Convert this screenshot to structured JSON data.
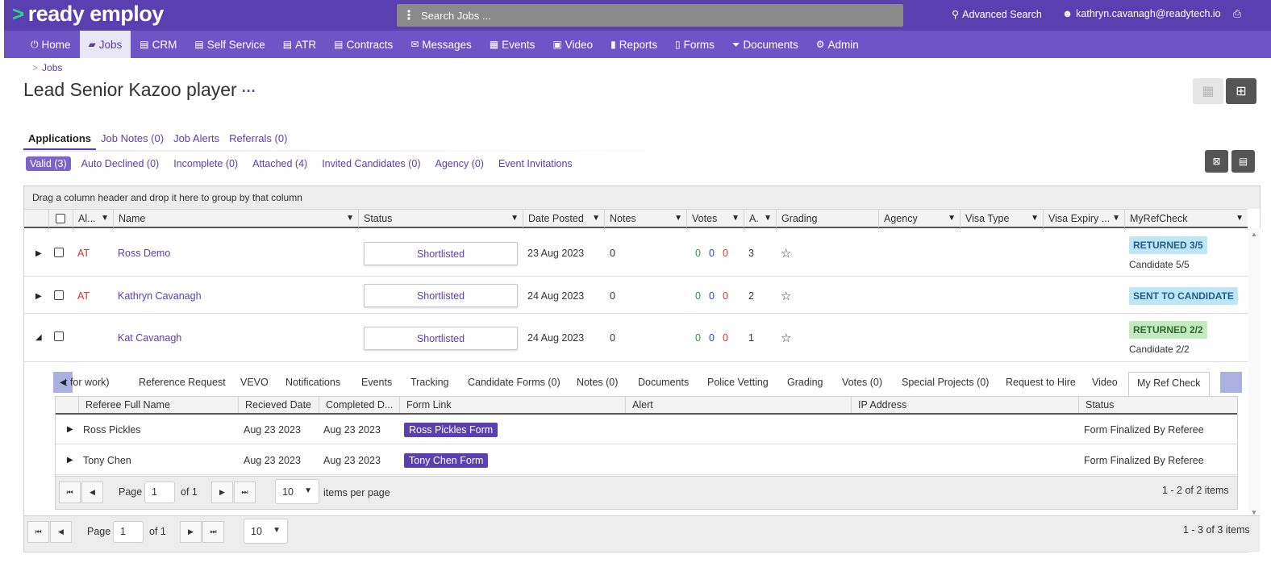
{
  "app": {
    "brand": "ready employ",
    "search_placeholder": "Search Jobs ...",
    "advanced_search": "Advanced Search",
    "user_email": "kathryn.cavanagh@readytech.io"
  },
  "nav": [
    {
      "label": "Home",
      "icon": "⏻"
    },
    {
      "label": "Jobs",
      "icon": "▰"
    },
    {
      "label": "CRM",
      "icon": "▤"
    },
    {
      "label": "Self Service",
      "icon": "▤"
    },
    {
      "label": "ATR",
      "icon": "▤"
    },
    {
      "label": "Contracts",
      "icon": "▤"
    },
    {
      "label": "Messages",
      "icon": "✉"
    },
    {
      "label": "Events",
      "icon": "▦"
    },
    {
      "label": "Video",
      "icon": "▣"
    },
    {
      "label": "Reports",
      "icon": "▮"
    },
    {
      "label": "Forms",
      "icon": "▯"
    },
    {
      "label": "Documents",
      "icon": "⏷"
    },
    {
      "label": "Admin",
      "icon": "⚙"
    }
  ],
  "breadcrumb": {
    "sep": ">",
    "item": "Jobs"
  },
  "page": {
    "title": "Lead Senior Kazoo player",
    "more": "···"
  },
  "main_tabs": [
    "Applications",
    "Job Notes (0)",
    "Job Alerts",
    "Referrals (0)"
  ],
  "sub_tabs": [
    "Valid (3)",
    "Auto Declined (0)",
    "Incomplete (0)",
    "Attached (4)",
    "Invited Candidates (0)",
    "Agency (0)",
    "Event Invitations"
  ],
  "grid": {
    "group_hint": "Drag a column header and drop it here to group by that column",
    "columns": [
      "Al...",
      "Name",
      "Status",
      "Date Posted",
      "Notes",
      "Votes",
      "A.",
      "Grading",
      "Agency",
      "Visa Type",
      "Visa Expiry ...",
      "MyRefCheck"
    ],
    "rows": [
      {
        "alert": "AT",
        "name": "Ross Demo",
        "status": "Shortlisted",
        "date": "23 Aug 2023",
        "notes": "0",
        "votes": [
          "0",
          "0",
          "0"
        ],
        "a": "3",
        "grading": "☆",
        "ref_badge": "RETURNED 3/5",
        "ref_sub": "Candidate 5/5",
        "expander": "▶"
      },
      {
        "alert": "AT",
        "name": "Kathryn Cavanagh",
        "status": "Shortlisted",
        "date": "24 Aug 2023",
        "notes": "0",
        "votes": [
          "0",
          "0",
          "0"
        ],
        "a": "2",
        "grading": "☆",
        "ref_badge": "SENT TO CANDIDATE",
        "ref_sub": "",
        "expander": "▶"
      },
      {
        "alert": "",
        "name": "Kat Cavanagh",
        "status": "Shortlisted",
        "date": "24 Aug 2023",
        "notes": "0",
        "votes": [
          "0",
          "0",
          "0"
        ],
        "a": "1",
        "grading": "☆",
        "ref_badge": "RETURNED 2/2",
        "ref_sub": "Candidate 2/2",
        "expander": "◢"
      }
    ],
    "pager": {
      "page_label": "Page",
      "page": "1",
      "of": "of 1",
      "size": "10",
      "summary": "1 - 3 of 3 items"
    }
  },
  "detail": {
    "tabs": [
      "t for work)",
      "Reference Request",
      "VEVO",
      "Notifications",
      "Events",
      "Tracking",
      "Candidate Forms (0)",
      "Notes (0)",
      "Documents",
      "Police Vetting",
      "Grading",
      "Votes (0)",
      "Special Projects (0)",
      "Request to Hire",
      "Video",
      "My Ref Check"
    ],
    "columns": [
      "Referee Full Name",
      "Recieved Date",
      "Completed D...",
      "Form Link",
      "Alert",
      "IP Address",
      "Status"
    ],
    "rows": [
      {
        "name": "Ross Pickles",
        "received": "Aug 23 2023",
        "completed": "Aug 23 2023",
        "form": "Ross Pickles Form",
        "status": "Form Finalized By Referee"
      },
      {
        "name": "Tony Chen",
        "received": "Aug 23 2023",
        "completed": "Aug 23 2023",
        "form": "Tony Chen Form",
        "status": "Form Finalized By Referee"
      }
    ],
    "pager": {
      "page_label": "Page",
      "page": "1",
      "of": "of 1",
      "size": "10",
      "per_page": "items per page",
      "summary": "1 - 2 of 2 items"
    }
  },
  "colors": {
    "brand": "#5a3fb0",
    "nav": "#6f54c6",
    "accent_green": "#2ed38a"
  }
}
